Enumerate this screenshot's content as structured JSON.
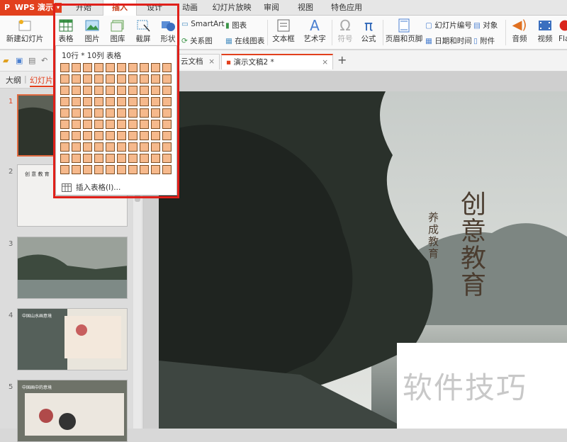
{
  "app": {
    "logo": "P",
    "name": "WPS 演示"
  },
  "tabs": [
    {
      "label": "开始"
    },
    {
      "label": "插入"
    },
    {
      "label": "设计"
    },
    {
      "label": "动画"
    },
    {
      "label": "幻灯片放映"
    },
    {
      "label": "审阅"
    },
    {
      "label": "视图"
    },
    {
      "label": "特色应用"
    }
  ],
  "ribbon": {
    "new_slide": "新建幻灯片",
    "table": "表格",
    "picture": "图片",
    "gallery": "图库",
    "screenshot": "截屏",
    "shape": "形状",
    "smartart": "SmartArt",
    "chart": "图表",
    "relation": "关系图",
    "online_chart": "在线图表",
    "textbox": "文本框",
    "wordart": "艺术字",
    "symbol": "符号",
    "formula": "公式",
    "header_footer": "页眉和页脚",
    "slide_number": "幻灯片编号",
    "object": "对象",
    "datetime": "日期和时间",
    "attachment": "附件",
    "audio": "音频",
    "video": "视频",
    "flash": "Fla"
  },
  "doc_tabs": [
    {
      "label": "云文档"
    },
    {
      "label": "演示文稿2 *"
    }
  ],
  "panel": {
    "outline": "大纲",
    "slides": "幻灯片"
  },
  "thumbs": [
    {
      "num": "1"
    },
    {
      "num": "2",
      "text": "创 意 教 育"
    },
    {
      "num": "3"
    },
    {
      "num": "4",
      "text": "中国山水画意境"
    },
    {
      "num": "5",
      "text": "中国画中的意境"
    }
  ],
  "table_dropdown": {
    "header": "10行 * 10列 表格",
    "rows": 10,
    "cols": 10,
    "insert_label": "插入表格(I)..."
  },
  "slide": {
    "title": "创意教育",
    "subtitle": "养成教育"
  },
  "watermark": "软件技巧",
  "colors": {
    "accent": "#e2401d",
    "cell_fill": "#f6b98c",
    "highlight": "#e0201a"
  }
}
